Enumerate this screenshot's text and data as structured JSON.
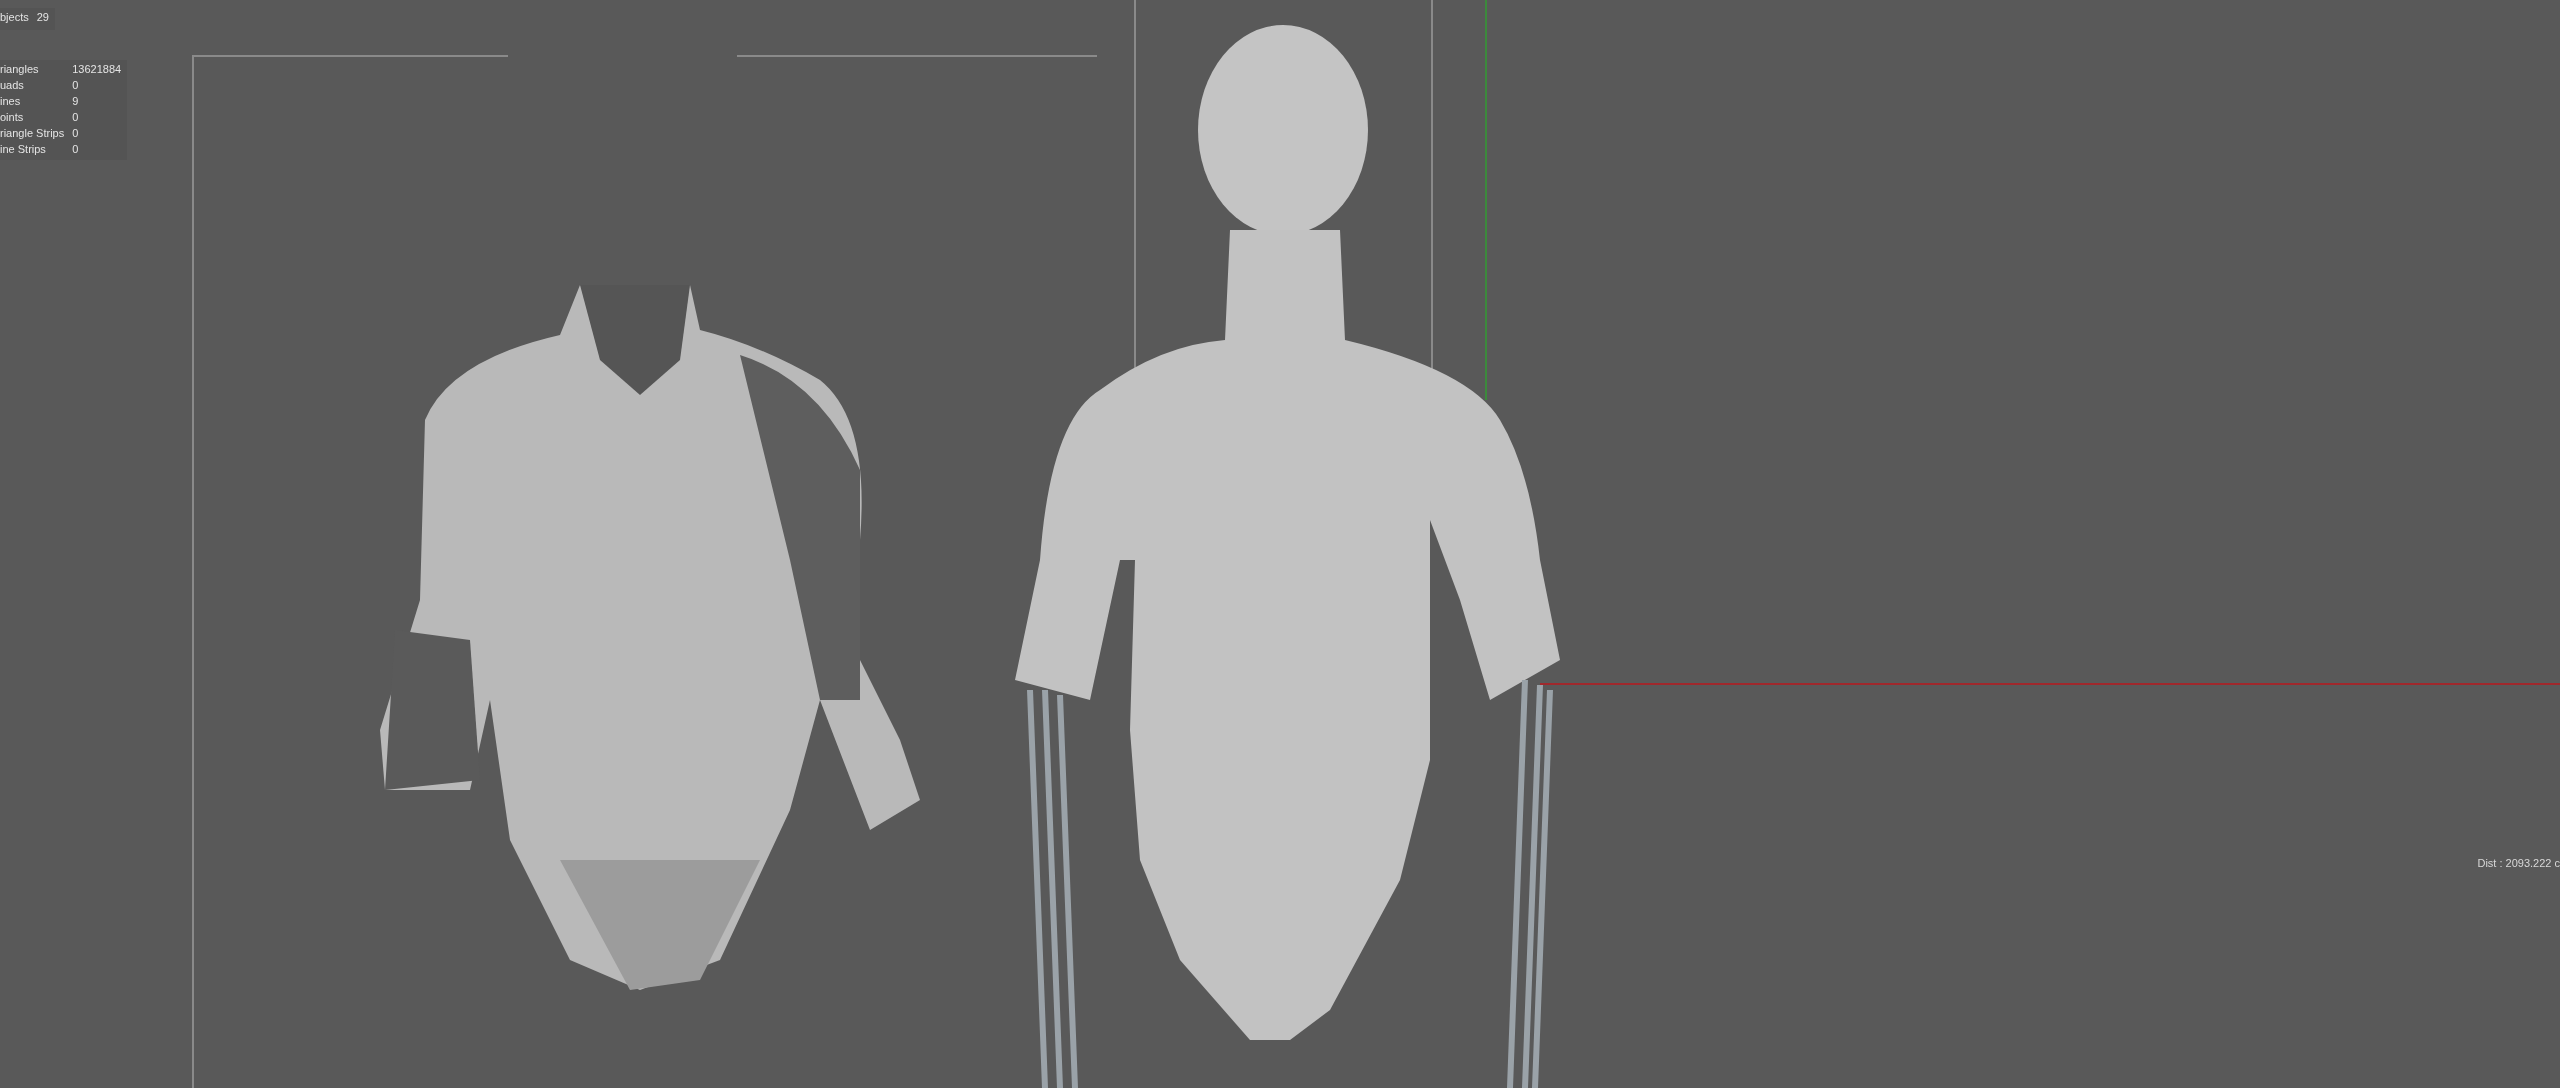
{
  "scene_stats": {
    "rows": [
      {
        "label": "bjects",
        "value": "29"
      }
    ]
  },
  "primitive_stats": {
    "rows": [
      {
        "label": "riangles",
        "value": "13621884"
      },
      {
        "label": "uads",
        "value": "0"
      },
      {
        "label": "ines",
        "value": "9"
      },
      {
        "label": "oints",
        "value": "0"
      },
      {
        "label": "riangle Strips",
        "value": "0"
      },
      {
        "label": "ine Strips",
        "value": "0"
      }
    ]
  },
  "viewport": {
    "distance_readout": "Dist : 2093.222 c"
  }
}
